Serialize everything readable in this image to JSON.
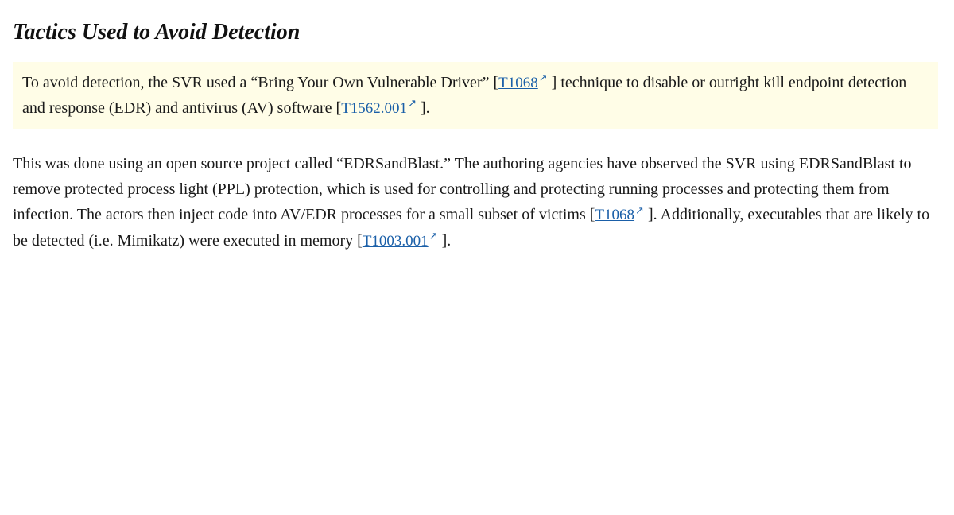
{
  "page": {
    "title": "Tactics Used to Avoid Detection",
    "paragraph1": {
      "text_before_link1": "To avoid detection, the SVR used a “Bring Your Own Vulnerable Driver” [",
      "link1_text": "T1068",
      "link1_href": "#T1068",
      "text_after_link1": " ] technique to disable or outright kill endpoint detection and response (EDR) and antivirus (AV) software [",
      "link2_text": "T1562.001",
      "link2_href": "#T1562.001",
      "text_after_link2": " ]."
    },
    "paragraph2": {
      "text_before_link1": "This was done using an open source project called “EDRSandBlast.” The authoring agencies have observed the SVR using EDRSandBlast to remove protected process light (PPL) protection, which is used for controlling and protecting running processes and protecting them from infection. The actors then inject code into AV/EDR processes for a small subset of victims [",
      "link1_text": "T1068",
      "link1_href": "#T1068",
      "text_after_link1": " ]. Additionally, executables that are likely to be detected (i.e. Mimikatz) were executed in memory [",
      "link2_text": "T1003.001",
      "link2_href": "#T1003.001",
      "text_after_link2": " ]."
    },
    "ext_icon_symbol": "↗",
    "colors": {
      "highlight_bg": "#fffde7",
      "link_color": "#1a5fa8"
    }
  }
}
